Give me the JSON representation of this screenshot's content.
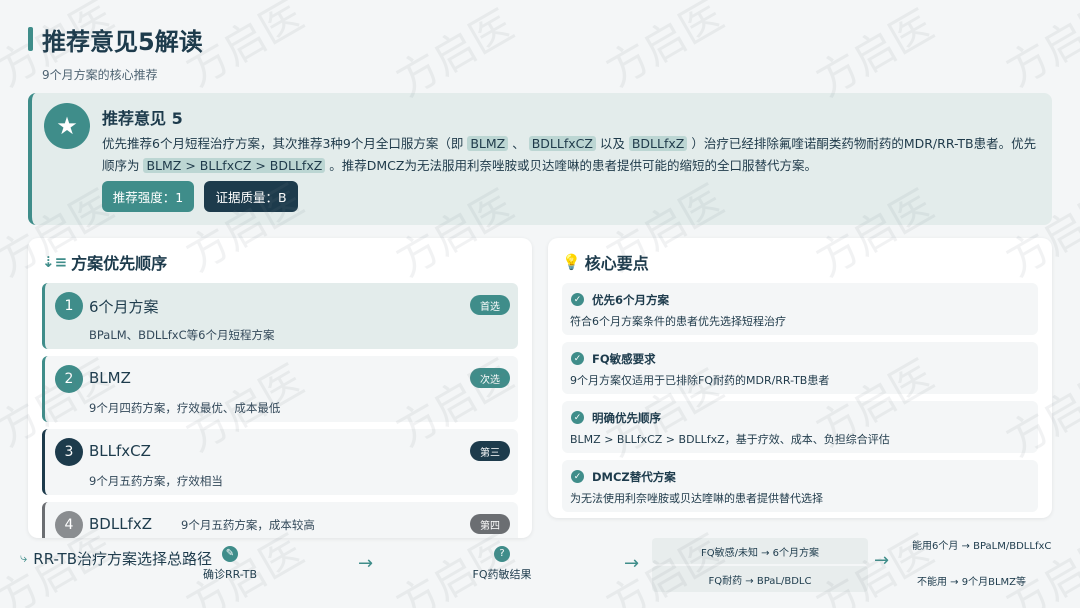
{
  "header": {
    "title": "推荐意见5解读",
    "subtitle": "9个月方案的核心推荐"
  },
  "recommendation": {
    "title": "推荐意见 5",
    "text_parts": [
      "优先推荐6个月短程治疗方案，其次推荐3种9个月全口服方案（即 ",
      "BLMZ",
      " 、 ",
      "BDLLfxCZ",
      " 以及 ",
      "BDLLfxZ",
      " ）治疗已经排除氟喹诺酮类药物耐药的MDR/RR-TB患者。优先顺序为 ",
      "BLMZ > BLLfxCZ > BDLLfxZ",
      " 。推荐DMCZ为无法服用利奈唑胺或贝达喹啉的患者提供可能的缩短的全口服替代方案。"
    ],
    "strength": "推荐强度：1",
    "quality": "证据质量：B",
    "icon": "star-icon"
  },
  "priority": {
    "title": "方案优先顺序",
    "icon": "sort-icon",
    "items": [
      {
        "num": "1",
        "name": "6个月方案",
        "desc": "BPaLM、BDLLfxC等6个月短程方案",
        "tag": "首选"
      },
      {
        "num": "2",
        "name": "BLMZ",
        "desc": "9个月四药方案，疗效最优、成本最低",
        "tag": "次选"
      },
      {
        "num": "3",
        "name": "BLLfxCZ",
        "desc": "9个月五药方案，疗效相当",
        "tag": "第三"
      },
      {
        "num": "4",
        "name": "BDLLfxZ",
        "desc": "9个月五药方案，成本较高",
        "tag": "第四"
      }
    ]
  },
  "keypoints": {
    "title": "核心要点",
    "icon": "lightbulb-icon",
    "items": [
      {
        "title": "优先6个月方案",
        "desc": "符合6个月方案条件的患者优先选择短程治疗"
      },
      {
        "title": "FQ敏感要求",
        "desc": "9个月方案仅适用于已排除FQ耐药的MDR/RR-TB患者"
      },
      {
        "title": "明确优先顺序",
        "desc": "BLMZ > BLLfxCZ > BDLLfxZ，基于疗效、成本、负担综合评估"
      },
      {
        "title": "DMCZ替代方案",
        "desc": "为无法使用利奈唑胺或贝达喹啉的患者提供替代选择"
      }
    ]
  },
  "pathway": {
    "title": "RR-TB治疗方案选择总路径",
    "icon": "route-icon",
    "step1": "确诊RR-TB",
    "step2": "FQ药敏结果",
    "step2_icon": "?",
    "branch_sensitive": "FQ敏感/未知 → 6个月方案",
    "branch_resistant": "FQ耐药 → BPaL/BDLC",
    "can_6m": "能用6个月 → BPaLM/BDLLfxC",
    "cannot_6m": "不能用 → 9个月BLMZ等",
    "arrow": "→"
  },
  "watermark": "方启医"
}
